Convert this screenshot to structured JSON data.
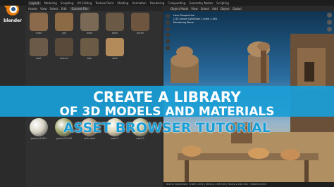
{
  "app": {
    "brand": "blender",
    "menu": [
      "Layout",
      "Modeling",
      "Sculpting",
      "UV Editing",
      "Texture Paint",
      "Shading",
      "Animation",
      "Rendering",
      "Compositing",
      "Geometry Nodes",
      "Scripting"
    ],
    "active_menu_index": 0
  },
  "asset_browser": {
    "header_items": [
      "Assets",
      "View",
      "Select",
      "Edit"
    ],
    "library_label": "Current File",
    "rows": [
      {
        "items": [
          {
            "label": "crate",
            "icon": "crate-icon",
            "color": "#8a6a4a"
          },
          {
            "label": "pot",
            "icon": "pot-icon",
            "color": "#8c6a45"
          },
          {
            "label": "lamp",
            "icon": "lamp-icon",
            "color": "#7a6a55"
          },
          {
            "label": "bowl",
            "icon": "bowl-icon",
            "color": "#6a5a45"
          },
          {
            "label": "barrel",
            "icon": "barrel-icon",
            "color": "#6e5540"
          }
        ]
      },
      {
        "items": [
          {
            "label": "post",
            "icon": "post-icon",
            "color": "#6b5a48"
          },
          {
            "label": "lantern",
            "icon": "lantern-icon",
            "color": "#5a4a3a"
          },
          {
            "label": "sign",
            "icon": "sign-icon",
            "color": "#6b5b45"
          },
          {
            "label": "sack",
            "icon": "sack-icon",
            "color": "#b38a5a"
          },
          {
            "label": "",
            "icon": "",
            "color": ""
          }
        ]
      },
      {
        "items": [
          {
            "label": "ground 4.001",
            "icon": "material-ball-icon",
            "color": "#d8d3c4"
          },
          {
            "label": "ground 5.001",
            "icon": "material-ball-icon",
            "color": "#9fa36a"
          },
          {
            "label": "rock sand",
            "icon": "material-ball-icon",
            "color": "#b39a7a"
          },
          {
            "label": "sand 2",
            "icon": "material-ball-icon",
            "color": "#d9cfb0"
          },
          {
            "label": "sand 3",
            "icon": "material-ball-icon",
            "color": "#b9b38a"
          }
        ]
      }
    ]
  },
  "viewport": {
    "header_items": [
      "Object Mode",
      "View",
      "Select",
      "Add",
      "Object",
      "Global"
    ],
    "info_lines": [
      "User Perspective",
      "(10) Scene Collection | crate 1.001",
      "Rendering Done"
    ],
    "status_text": "Scene Collection | crate 1.001 | Verts:1,249,741 | Faces:1,242,541 | Objects:0/31"
  },
  "banner": {
    "line1": "CREATE A LIBRARY",
    "line2": "OF 3D MODELS AND MATERIALS",
    "line3": "ASSET BROWSER TUTORIAL"
  },
  "colors": {
    "accent": "#1a9ed6",
    "panel": "#303030",
    "topbar": "#1d1d1d"
  }
}
